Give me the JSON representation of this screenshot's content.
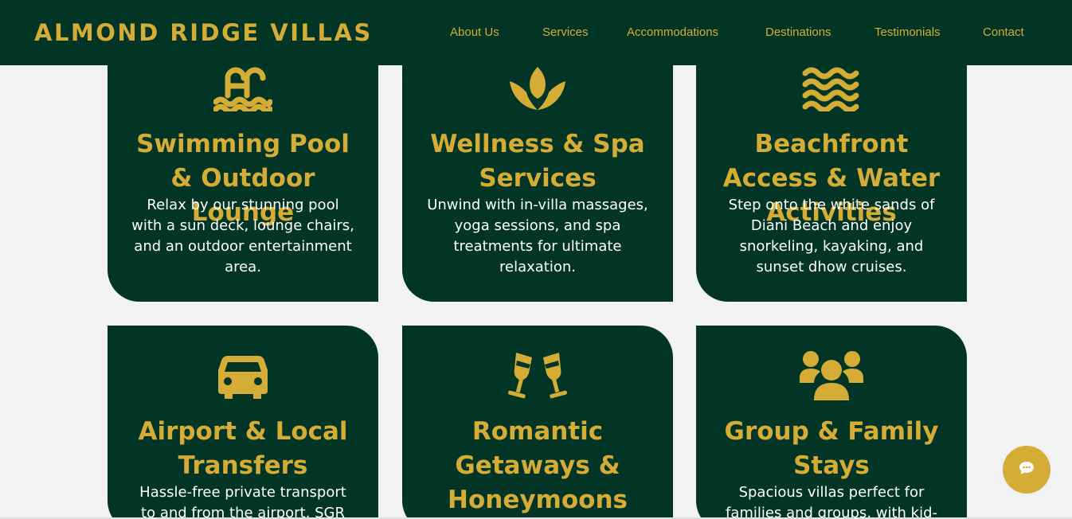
{
  "header": {
    "brand": "ALMOND RIDGE VILLAS",
    "nav": [
      "About Us",
      "Services",
      "Accommodations",
      "Destinations",
      "Testimonials",
      "Contact"
    ]
  },
  "cards": [
    {
      "icon": "swimming-pool-icon",
      "title": "Swimming Pool & Outdoor Lounge",
      "desc": "Relax by our stunning pool with a sun deck, lounge chairs, and an outdoor entertainment area."
    },
    {
      "icon": "lotus-spa-icon",
      "title": "Wellness & Spa Services",
      "desc": "Unwind with in-villa massages, yoga sessions, and spa treatments for ultimate relaxation."
    },
    {
      "icon": "water-waves-icon",
      "title": "Beachfront Access & Water Activities",
      "desc": "Step onto the white sands of Diani Beach and enjoy snorkeling, kayaking, and sunset dhow cruises."
    },
    {
      "icon": "car-icon",
      "title": "Airport & Local Transfers",
      "desc": "Hassle-free private transport to and from the airport, SGR"
    },
    {
      "icon": "champagne-glasses-icon",
      "title": "Romantic Getaways & Honeymoons",
      "desc": ""
    },
    {
      "icon": "group-users-icon",
      "title": "Group & Family Stays",
      "desc": "Spacious villas perfect for families and groups, with kid-"
    }
  ],
  "chat": {
    "icon": "chat-bubble-icon"
  },
  "colors": {
    "primary": "#033527",
    "accent": "#d4ac36",
    "background": "#f2f2f4"
  }
}
